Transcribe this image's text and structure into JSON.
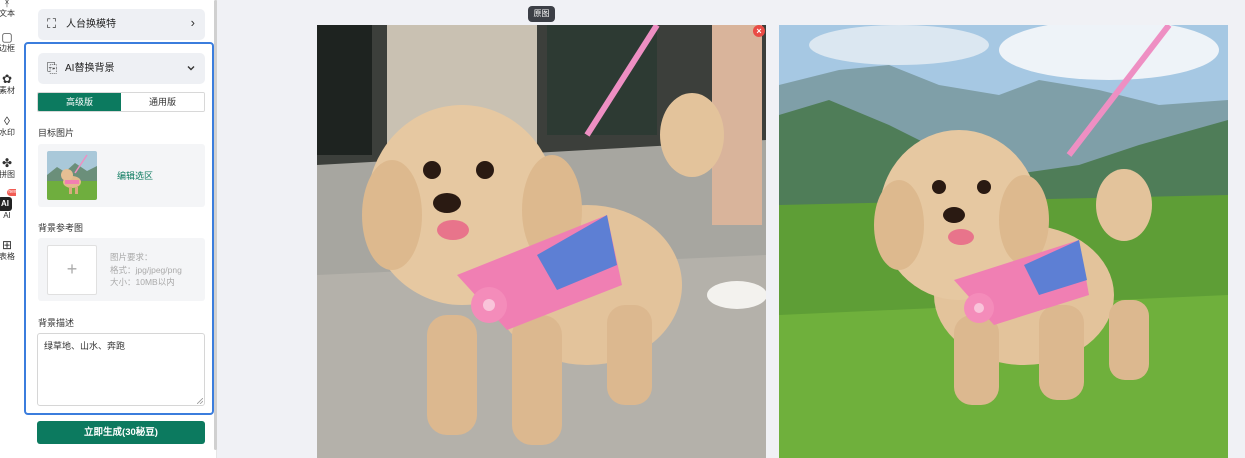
{
  "rail": {
    "items": [
      {
        "icon": "text-icon",
        "label": "文本"
      },
      {
        "icon": "frame-icon",
        "label": "边框"
      },
      {
        "icon": "material-icon",
        "label": "素材"
      },
      {
        "icon": "watermark-icon",
        "label": "水印"
      },
      {
        "icon": "puzzle-icon",
        "label": "拼图"
      },
      {
        "icon": "ai-icon",
        "label": "AI"
      },
      {
        "icon": "table-icon",
        "label": "表格"
      }
    ],
    "ai_glyph": "AI",
    "new_badge": "new"
  },
  "panel": {
    "mannequin_item": {
      "label": "人台换模特",
      "icon": "mannequin-icon"
    },
    "ai_bg": {
      "label": "AI替换背景",
      "icon": "ai-bg-icon",
      "tabs": [
        {
          "label": "高级版",
          "active": true
        },
        {
          "label": "通用版",
          "active": false
        }
      ],
      "target_label": "目标图片",
      "edit_link": "编辑选区",
      "ref_label": "背景参考图",
      "upload_plus": "+",
      "requirements": [
        "图片要求：",
        "格式：jpg/jpeg/png",
        "大小：10MB以内"
      ],
      "desc_label": "背景描述",
      "desc_value": "绿草地、山水、奔跑",
      "generate_button": "立即生成(30秘豆)"
    }
  },
  "canvas": {
    "original_badge": "原图",
    "close_glyph": "×",
    "images": [
      {
        "name": "original-dog-photo",
        "scene": "poodle in pink harness walking on street pavement"
      },
      {
        "name": "generated-dog-photo",
        "scene": "poodle in pink harness running on green meadow with mountains"
      }
    ]
  },
  "colors": {
    "accent": "#0c7a5f",
    "highlight_border": "#3b7ddd",
    "close_red": "#e94b45",
    "new_badge": "#f25c54"
  }
}
